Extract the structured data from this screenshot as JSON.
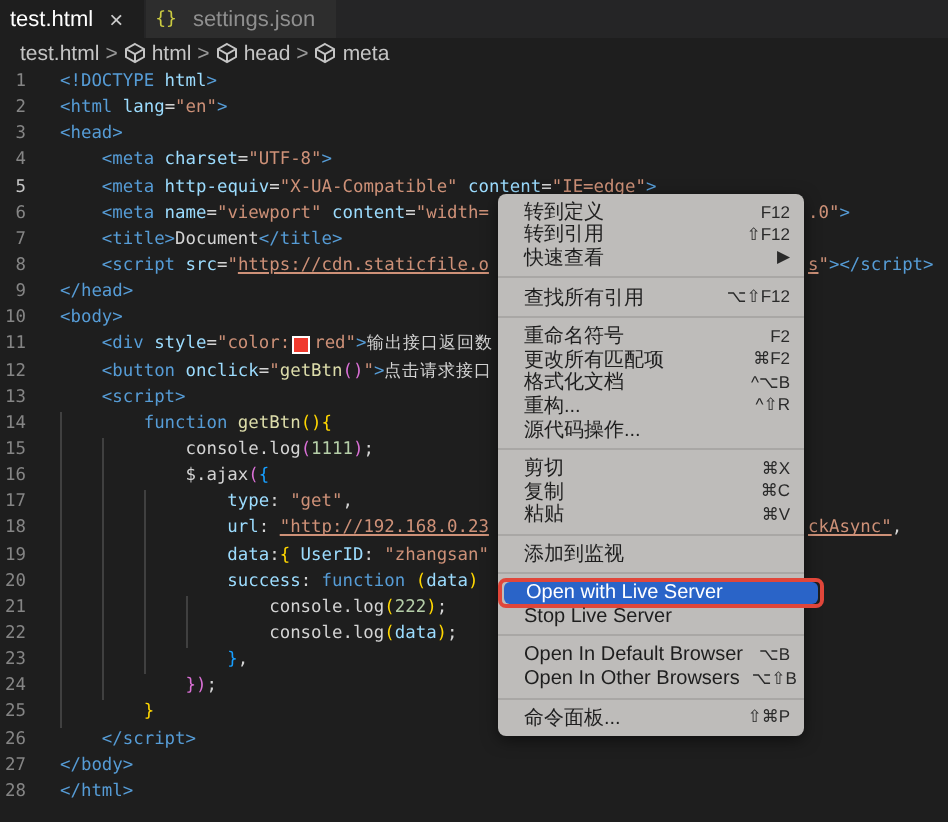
{
  "tabs": [
    {
      "label": "test.html",
      "selected": true,
      "close": "×"
    },
    {
      "label": "settings.json",
      "selected": false,
      "icon_text": "{}"
    }
  ],
  "breadcrumb": [
    {
      "label": "test.html",
      "symbol": false
    },
    {
      "separator": ">",
      "label": "html",
      "symbol": true
    },
    {
      "separator": ">",
      "label": "head",
      "symbol": true
    },
    {
      "separator": ">",
      "label": "meta",
      "symbol": true
    }
  ],
  "editor": {
    "lines": [
      {
        "number": "1",
        "current": false,
        "tokens": [
          {
            "kind": "tag",
            "text": "<!DOCTYPE"
          },
          {
            "kind": "attr",
            "text": " html"
          },
          {
            "kind": "tag",
            "text": ">"
          }
        ]
      },
      {
        "number": "2",
        "current": false,
        "tokens": [
          {
            "kind": "tag",
            "text": "<html"
          },
          {
            "kind": "attr",
            "text": " lang"
          },
          {
            "kind": "punct",
            "text": "="
          },
          {
            "kind": "str",
            "text": "\"en\""
          },
          {
            "kind": "tag",
            "text": ">"
          }
        ]
      },
      {
        "number": "3",
        "current": false,
        "tokens": [
          {
            "kind": "tag",
            "text": "<head>"
          }
        ]
      },
      {
        "number": "4",
        "current": false,
        "tokens": [
          {
            "kind": "tag",
            "text": "    <meta"
          },
          {
            "kind": "attr",
            "text": " charset"
          },
          {
            "kind": "punct",
            "text": "="
          },
          {
            "kind": "str",
            "text": "\"UTF-8\""
          },
          {
            "kind": "tag",
            "text": ">"
          }
        ]
      },
      {
        "number": "5",
        "current": true,
        "tokens": [
          {
            "kind": "tag",
            "text": "    <meta"
          },
          {
            "kind": "attr",
            "text": " http-equiv"
          },
          {
            "kind": "punct",
            "text": "="
          },
          {
            "kind": "str",
            "text": "\"X-UA-Compatible\""
          },
          {
            "kind": "attr",
            "text": " content"
          },
          {
            "kind": "punct",
            "text": "="
          },
          {
            "kind": "str",
            "text": "\"IE=edge\""
          },
          {
            "kind": "tag",
            "text": ">"
          }
        ]
      },
      {
        "number": "6",
        "current": false,
        "tokens": [
          {
            "kind": "tag",
            "text": "    <meta"
          },
          {
            "kind": "attr",
            "text": " name"
          },
          {
            "kind": "punct",
            "text": "="
          },
          {
            "kind": "str",
            "text": "\"viewport\""
          },
          {
            "kind": "attr",
            "text": " content"
          },
          {
            "kind": "punct",
            "text": "="
          },
          {
            "kind": "str",
            "text": "\"width="
          }
        ],
        "tail": [
          {
            "kind": "str",
            "text": ".0\""
          },
          {
            "kind": "tag",
            "text": ">"
          }
        ]
      },
      {
        "number": "7",
        "current": false,
        "tokens": [
          {
            "kind": "tag",
            "text": "    <title>"
          },
          {
            "kind": "text",
            "text": "Document"
          },
          {
            "kind": "tag",
            "text": "</title>"
          }
        ]
      },
      {
        "number": "8",
        "current": false,
        "tokens": [
          {
            "kind": "tag",
            "text": "    <script"
          },
          {
            "kind": "attr",
            "text": " src"
          },
          {
            "kind": "punct",
            "text": "="
          },
          {
            "kind": "str",
            "text": "\""
          },
          {
            "kind": "link",
            "text": "https://cdn.staticfile.o"
          }
        ],
        "tail": [
          {
            "kind": "link",
            "text": "s"
          },
          {
            "kind": "str",
            "text": "\""
          },
          {
            "kind": "tag",
            "text": "></script>"
          }
        ]
      },
      {
        "number": "9",
        "current": false,
        "tokens": [
          {
            "kind": "tag",
            "text": "</head>"
          }
        ]
      },
      {
        "number": "10",
        "current": false,
        "tokens": [
          {
            "kind": "tag",
            "text": "<body>"
          }
        ]
      },
      {
        "number": "11",
        "current": false,
        "tokens": [
          {
            "kind": "tag",
            "text": "    <div"
          },
          {
            "kind": "attr",
            "text": " style"
          },
          {
            "kind": "punct",
            "text": "="
          },
          {
            "kind": "str",
            "text": "\"color:"
          },
          {
            "kind": "swatch",
            "color": "#f03a2e"
          },
          {
            "kind": "str",
            "text": "red\""
          },
          {
            "kind": "tag",
            "text": ">"
          },
          {
            "kind": "text",
            "text": "输出接口返回数"
          }
        ]
      },
      {
        "number": "12",
        "current": false,
        "tokens": [
          {
            "kind": "tag",
            "text": "    <button"
          },
          {
            "kind": "attr",
            "text": " onclick"
          },
          {
            "kind": "punct",
            "text": "="
          },
          {
            "kind": "str",
            "text": "\""
          },
          {
            "kind": "fn",
            "text": "getBtn"
          },
          {
            "kind": "b2",
            "text": "()"
          },
          {
            "kind": "str",
            "text": "\""
          },
          {
            "kind": "tag",
            "text": ">"
          },
          {
            "kind": "text",
            "text": "点击请求接口"
          }
        ]
      },
      {
        "number": "13",
        "current": false,
        "tokens": [
          {
            "kind": "tag",
            "text": "    <script>"
          }
        ]
      },
      {
        "number": "14",
        "current": false,
        "tokens": [
          {
            "kind": "kw",
            "text": "        function"
          },
          {
            "kind": "fn",
            "text": " getBtn"
          },
          {
            "kind": "b1",
            "text": "(){"
          }
        ]
      },
      {
        "number": "15",
        "current": false,
        "tokens": [
          {
            "kind": "text",
            "text": "            console.log"
          },
          {
            "kind": "b2",
            "text": "("
          },
          {
            "kind": "num",
            "text": "1111"
          },
          {
            "kind": "b2",
            "text": ")"
          },
          {
            "kind": "text",
            "text": ";"
          }
        ]
      },
      {
        "number": "16",
        "current": false,
        "tokens": [
          {
            "kind": "text",
            "text": "            $.ajax"
          },
          {
            "kind": "b2",
            "text": "("
          },
          {
            "kind": "b3",
            "text": "{"
          }
        ]
      },
      {
        "number": "17",
        "current": false,
        "tokens": [
          {
            "kind": "var",
            "text": "                type"
          },
          {
            "kind": "text",
            "text": ": "
          },
          {
            "kind": "str",
            "text": "\"get\""
          },
          {
            "kind": "text",
            "text": ","
          }
        ]
      },
      {
        "number": "18",
        "current": false,
        "tokens": [
          {
            "kind": "var",
            "text": "                url"
          },
          {
            "kind": "text",
            "text": ": "
          },
          {
            "kind": "link",
            "text": "\"http://192.168.0.23"
          }
        ],
        "tail": [
          {
            "kind": "link",
            "text": "ckAsync\""
          },
          {
            "kind": "text",
            "text": ","
          }
        ]
      },
      {
        "number": "19",
        "current": false,
        "tokens": [
          {
            "kind": "var",
            "text": "                data"
          },
          {
            "kind": "text",
            "text": ":"
          },
          {
            "kind": "b1",
            "text": "{"
          },
          {
            "kind": "var",
            "text": " UserID"
          },
          {
            "kind": "text",
            "text": ": "
          },
          {
            "kind": "str",
            "text": "\"zhangsan\""
          }
        ]
      },
      {
        "number": "20",
        "current": false,
        "tokens": [
          {
            "kind": "var",
            "text": "                success"
          },
          {
            "kind": "text",
            "text": ": "
          },
          {
            "kind": "kw",
            "text": "function "
          },
          {
            "kind": "b1",
            "text": "("
          },
          {
            "kind": "var",
            "text": "data"
          },
          {
            "kind": "b1",
            "text": ")"
          }
        ]
      },
      {
        "number": "21",
        "current": false,
        "tokens": [
          {
            "kind": "text",
            "text": "                    console.log"
          },
          {
            "kind": "b1",
            "text": "("
          },
          {
            "kind": "num",
            "text": "222"
          },
          {
            "kind": "b1",
            "text": ")"
          },
          {
            "kind": "text",
            "text": ";"
          }
        ]
      },
      {
        "number": "22",
        "current": false,
        "tokens": [
          {
            "kind": "text",
            "text": "                    console.log"
          },
          {
            "kind": "b1",
            "text": "("
          },
          {
            "kind": "var",
            "text": "data"
          },
          {
            "kind": "b1",
            "text": ")"
          },
          {
            "kind": "text",
            "text": ";"
          }
        ]
      },
      {
        "number": "23",
        "current": false,
        "tokens": [
          {
            "kind": "b3",
            "text": "                }"
          },
          {
            "kind": "text",
            "text": ","
          }
        ]
      },
      {
        "number": "24",
        "current": false,
        "tokens": [
          {
            "kind": "b2",
            "text": "            })"
          },
          {
            "kind": "text",
            "text": ";"
          }
        ]
      },
      {
        "number": "25",
        "current": false,
        "tokens": [
          {
            "kind": "b1",
            "text": "        }"
          }
        ]
      },
      {
        "number": "26",
        "current": false,
        "tokens": [
          {
            "kind": "tag",
            "text": "    </script>"
          }
        ]
      },
      {
        "number": "27",
        "current": false,
        "tokens": [
          {
            "kind": "tag",
            "text": "</body>"
          }
        ]
      },
      {
        "number": "28",
        "current": false,
        "tokens": [
          {
            "kind": "tag",
            "text": "</html>"
          }
        ]
      }
    ]
  },
  "context_menu": {
    "groups": [
      [
        {
          "label": "转到定义",
          "shortcut": "F12",
          "selected": false,
          "outlined": false
        },
        {
          "label": "转到引用",
          "shortcut": "⇧F12",
          "selected": false,
          "outlined": false
        },
        {
          "label": "快速查看",
          "shortcut": "▶",
          "selected": false,
          "outlined": false
        }
      ],
      [
        {
          "label": "查找所有引用",
          "shortcut": "⌥⇧F12",
          "selected": false,
          "outlined": false
        }
      ],
      [
        {
          "label": "重命名符号",
          "shortcut": "F2",
          "selected": false,
          "outlined": false
        },
        {
          "label": "更改所有匹配项",
          "shortcut": "⌘F2",
          "selected": false,
          "outlined": false
        },
        {
          "label": "格式化文档",
          "shortcut": "^⌥B",
          "selected": false,
          "outlined": false
        },
        {
          "label": "重构...",
          "shortcut": "^⇧R",
          "selected": false,
          "outlined": false
        },
        {
          "label": "源代码操作...",
          "selected": false,
          "outlined": false
        }
      ],
      [
        {
          "label": "剪切",
          "shortcut": "⌘X",
          "selected": false,
          "outlined": false
        },
        {
          "label": "复制",
          "shortcut": "⌘C",
          "selected": false,
          "outlined": false
        },
        {
          "label": "粘贴",
          "shortcut": "⌘V",
          "selected": false,
          "outlined": false
        }
      ],
      [
        {
          "label": "添加到监视",
          "selected": false,
          "outlined": false
        }
      ],
      [
        {
          "label": "Open with Live Server",
          "selected": true,
          "outlined": true
        },
        {
          "label": "Stop Live Server",
          "selected": false,
          "outlined": false
        }
      ],
      [
        {
          "label": "Open In Default Browser",
          "shortcut": "⌥B",
          "selected": false,
          "outlined": false
        },
        {
          "label": "Open In Other Browsers",
          "shortcut": "⌥⇧B",
          "selected": false,
          "outlined": false
        }
      ],
      [
        {
          "label": "命令面板...",
          "shortcut": "⇧⌘P",
          "selected": false,
          "outlined": false
        }
      ]
    ]
  }
}
